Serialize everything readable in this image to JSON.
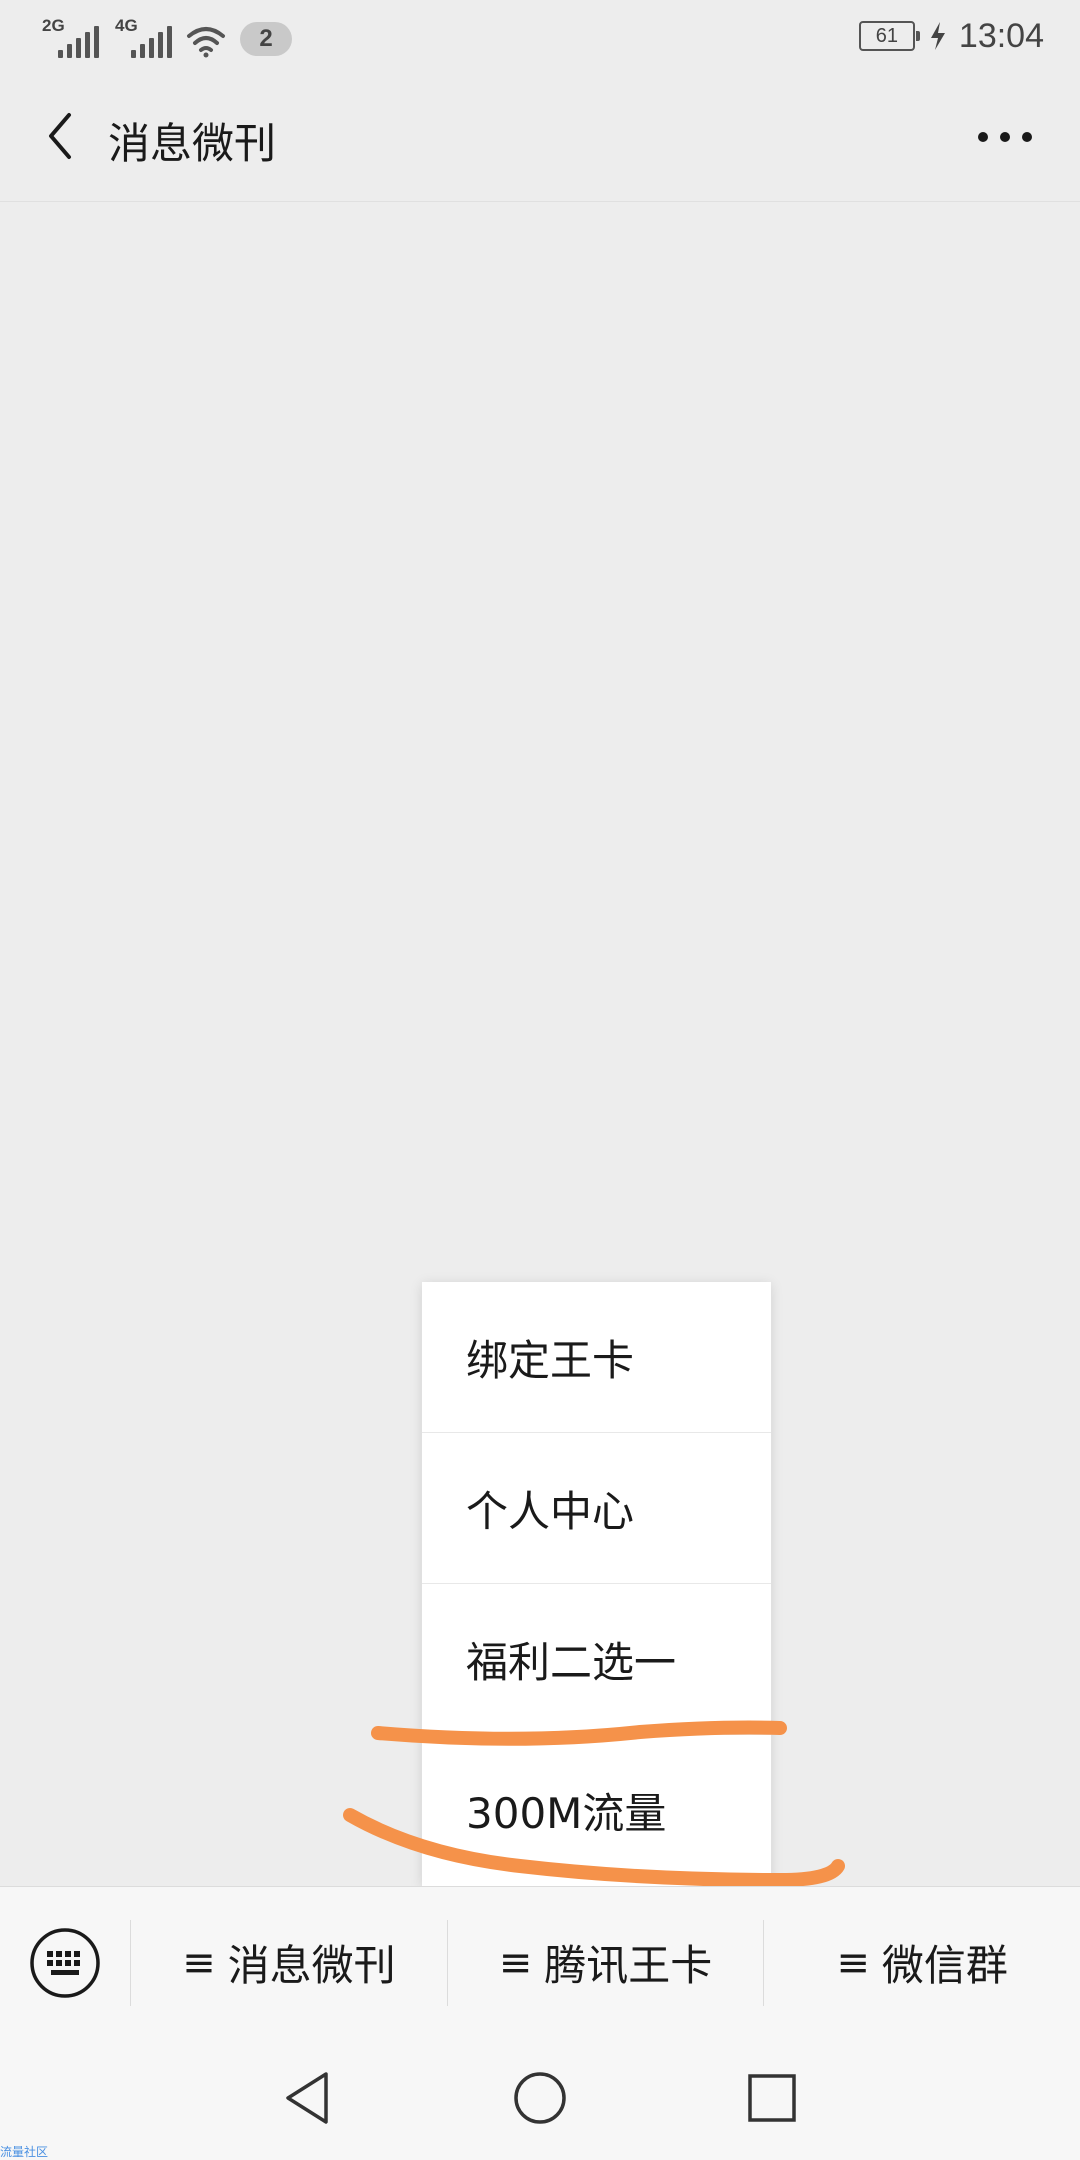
{
  "status_bar": {
    "sim1_network": "2G",
    "sim2_network": "4G",
    "notification_count": "2",
    "battery_level": "61",
    "time": "13:04"
  },
  "nav_bar": {
    "title": "消息微刊",
    "back_icon": "chevron-left-icon",
    "more_icon": "ellipsis-icon"
  },
  "popup_menu": {
    "items": [
      {
        "label": "绑定王卡"
      },
      {
        "label": "个人中心"
      },
      {
        "label": "福利二选一"
      },
      {
        "label": "300M流量"
      }
    ]
  },
  "annotation": {
    "color": "#f5924a"
  },
  "bottom_menu": {
    "keyboard_icon": "keyboard-icon",
    "tabs": [
      {
        "label": "消息微刊"
      },
      {
        "label": "腾讯王卡"
      },
      {
        "label": "微信群"
      }
    ]
  },
  "system_nav": {
    "watermark": "流量社区"
  }
}
